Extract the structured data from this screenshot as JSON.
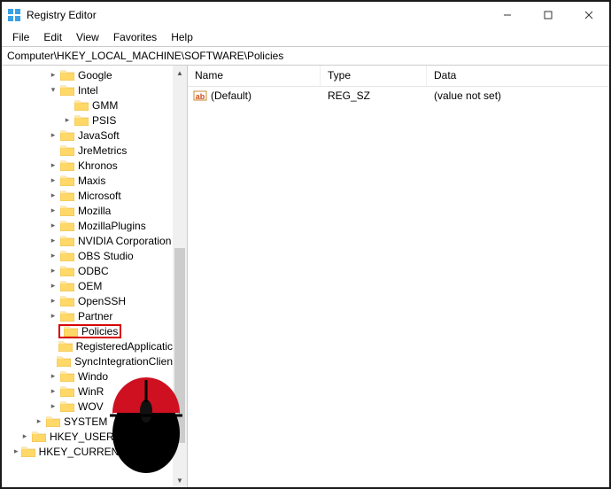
{
  "window": {
    "title": "Registry Editor"
  },
  "menu": {
    "items": [
      "File",
      "Edit",
      "View",
      "Favorites",
      "Help"
    ]
  },
  "addressbar": {
    "path": "Computer\\HKEY_LOCAL_MACHINE\\SOFTWARE\\Policies"
  },
  "tree": {
    "items": [
      {
        "indent": 3,
        "expander": "right",
        "label": "Google"
      },
      {
        "indent": 3,
        "expander": "down",
        "label": "Intel"
      },
      {
        "indent": 4,
        "expander": "",
        "label": "GMM",
        "dotted": true
      },
      {
        "indent": 4,
        "expander": "right",
        "label": "PSIS"
      },
      {
        "indent": 3,
        "expander": "right",
        "label": "JavaSoft"
      },
      {
        "indent": 3,
        "expander": "",
        "label": "JreMetrics"
      },
      {
        "indent": 3,
        "expander": "right",
        "label": "Khronos"
      },
      {
        "indent": 3,
        "expander": "right",
        "label": "Maxis"
      },
      {
        "indent": 3,
        "expander": "right",
        "label": "Microsoft"
      },
      {
        "indent": 3,
        "expander": "right",
        "label": "Mozilla"
      },
      {
        "indent": 3,
        "expander": "right",
        "label": "MozillaPlugins"
      },
      {
        "indent": 3,
        "expander": "right",
        "label": "NVIDIA Corporation"
      },
      {
        "indent": 3,
        "expander": "right",
        "label": "OBS Studio"
      },
      {
        "indent": 3,
        "expander": "right",
        "label": "ODBC"
      },
      {
        "indent": 3,
        "expander": "right",
        "label": "OEM"
      },
      {
        "indent": 3,
        "expander": "right",
        "label": "OpenSSH"
      },
      {
        "indent": 3,
        "expander": "right",
        "label": "Partner"
      },
      {
        "indent": 3,
        "expander": "",
        "label": "Policies",
        "highlight": true
      },
      {
        "indent": 3,
        "expander": "",
        "label": "RegisteredApplicatic"
      },
      {
        "indent": 3,
        "expander": "",
        "label": "SyncIntegrationClien"
      },
      {
        "indent": 3,
        "expander": "right",
        "label": "Windo"
      },
      {
        "indent": 3,
        "expander": "right",
        "label": "WinR"
      },
      {
        "indent": 3,
        "expander": "right",
        "label": "WOV"
      },
      {
        "indent": 2,
        "expander": "right",
        "label": "SYSTEM"
      },
      {
        "indent": 1,
        "expander": "right",
        "label": "HKEY_USER"
      },
      {
        "indent": 1,
        "expander": "right",
        "label": "HKEY_CURRENT_CONFIG"
      }
    ]
  },
  "list": {
    "columns": {
      "name": "Name",
      "type": "Type",
      "data": "Data"
    },
    "rows": [
      {
        "name": "(Default)",
        "type": "REG_SZ",
        "data": "(value not set)"
      }
    ]
  }
}
